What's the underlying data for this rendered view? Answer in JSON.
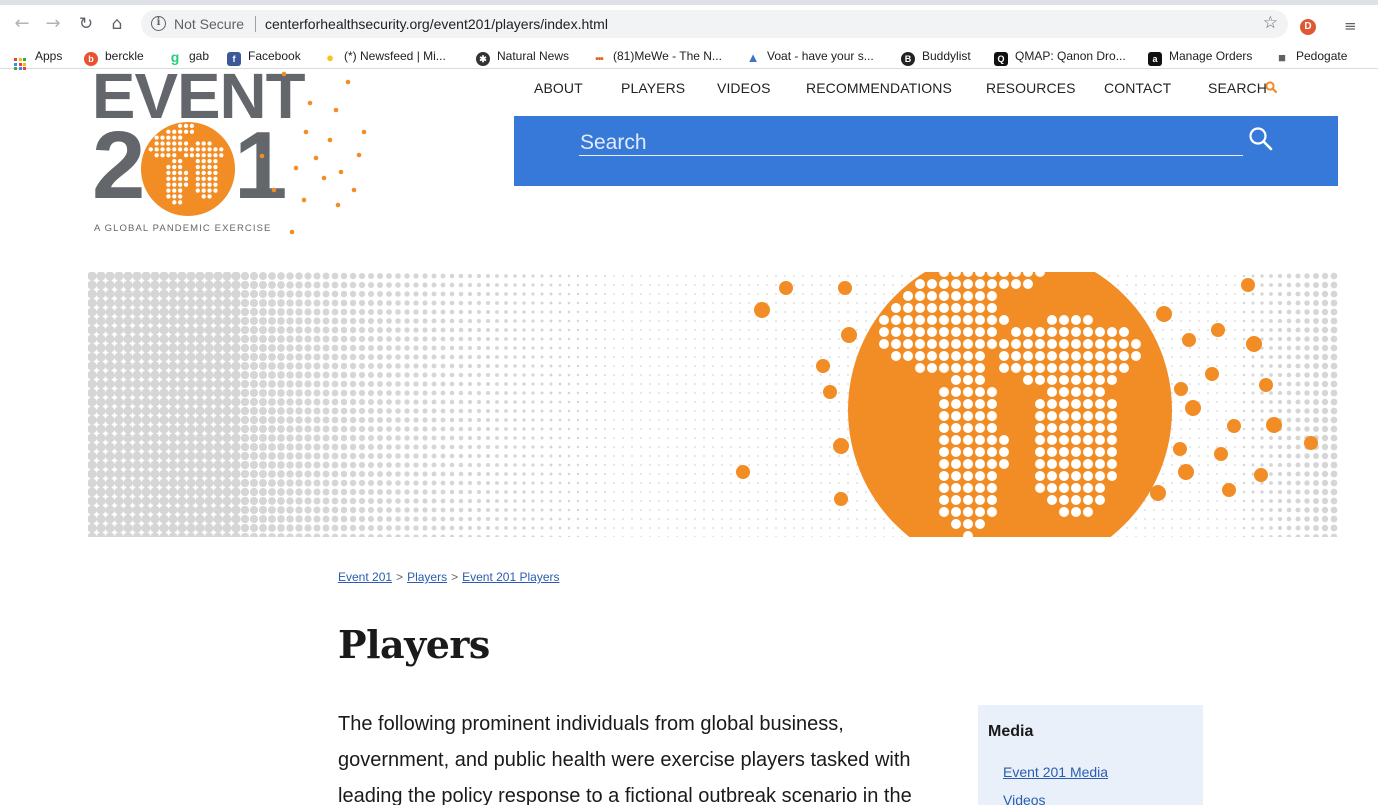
{
  "browser": {
    "security_label": "Not Secure",
    "url": "centerforhealthsecurity.org/event201/players/index.html",
    "bookmarks": [
      {
        "label": "Apps",
        "icon": "apps-grid-icon"
      },
      {
        "label": "berckle",
        "icon": "favicon-berckle",
        "color": "#e8522f"
      },
      {
        "label": "gab",
        "icon": "favicon-gab",
        "color": "#21cf7a"
      },
      {
        "label": "Facebook",
        "icon": "favicon-facebook",
        "color": "#3b5998"
      },
      {
        "label": "(*) Newsfeed | Mi...",
        "icon": "lightbulb-icon",
        "color": "#f5c518"
      },
      {
        "label": "Natural News",
        "icon": "favicon-naturalnews",
        "color": "#333333"
      },
      {
        "label": "(81)MeWe - The N...",
        "icon": "favicon-mewe",
        "color": "#e65c2a"
      },
      {
        "label": "Voat - have your s...",
        "icon": "favicon-voat",
        "color": "#3f74c4"
      },
      {
        "label": "Buddylist",
        "icon": "favicon-buddylist",
        "color": "#222222"
      },
      {
        "label": "QMAP: Qanon Dro...",
        "icon": "favicon-qmap",
        "color": "#111111"
      },
      {
        "label": "Manage Orders",
        "icon": "favicon-amazon",
        "color": "#111111"
      },
      {
        "label": "Pedogate",
        "icon": "folder-icon",
        "color": "#5f6368"
      }
    ]
  },
  "site": {
    "logo": {
      "word": "EVENT",
      "digit_left": "2",
      "digit_right": "1",
      "tagline": "A GLOBAL PANDEMIC EXERCISE"
    },
    "nav": [
      "ABOUT",
      "PLAYERS",
      "VIDEOS",
      "RECOMMENDATIONS",
      "RESOURCES",
      "CONTACT",
      "SEARCH"
    ],
    "search": {
      "placeholder": "Search"
    },
    "colors": {
      "accent_orange": "#f28c25",
      "search_blue": "#3679d9",
      "logo_gray": "#63666a",
      "link_blue": "#2a5db0"
    }
  },
  "breadcrumb": [
    "Event 201",
    "Players",
    "Event 201 Players"
  ],
  "page": {
    "title": "Players",
    "intro": "The following prominent individuals from global business, government, and public health were exercise players tasked with leading the policy response to a fictional outbreak scenario in the"
  },
  "sidebar": {
    "title": "Media",
    "links": [
      "Event 201 Media",
      "Videos"
    ]
  }
}
